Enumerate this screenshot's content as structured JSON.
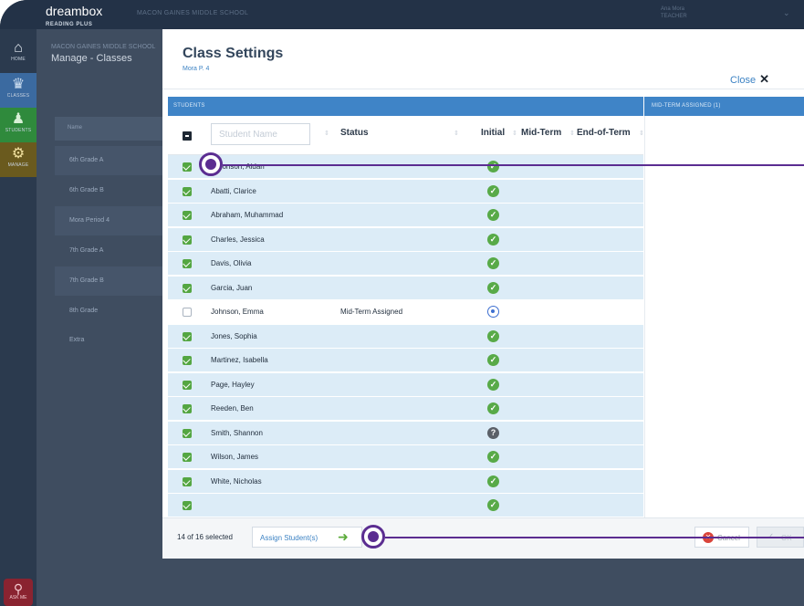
{
  "app": {
    "logo": "dreambox",
    "logo_sub": "READING PLUS",
    "school": "MACON GAINES MIDDLE SCHOOL",
    "user_name": "Ana Mora",
    "user_role": "TEACHER"
  },
  "rail": {
    "items": [
      {
        "label": "HOME",
        "icon": "home-icon"
      },
      {
        "label": "CLASSES",
        "icon": "classes-icon"
      },
      {
        "label": "STUDENTS",
        "icon": "students-icon"
      },
      {
        "label": "MANAGE",
        "icon": "gear-icon"
      }
    ],
    "bottom_label": "ASK ME"
  },
  "background": {
    "school": "MACON GAINES MIDDLE SCHOOL",
    "title": "Manage - Classes",
    "column": "Name",
    "classes": [
      "6th Grade A",
      "6th Grade B",
      "Mora Period 4",
      "7th Grade A",
      "7th Grade B",
      "8th Grade",
      "Extra"
    ]
  },
  "modal": {
    "title": "Class Settings",
    "subtitle": "Mora P. 4",
    "close_label": "Close",
    "students_header": "STUDENTS",
    "midterm_header": "MID-TERM ASSIGNED (1)",
    "search_placeholder": "Student Name",
    "columns": {
      "status": "Status",
      "initial": "Initial",
      "midterm": "Mid-Term",
      "endterm": "End-of-Term"
    },
    "students": [
      {
        "name": "Aaronson, Aidan",
        "status": "",
        "checked": true,
        "initial": "done"
      },
      {
        "name": "Abatti, Clarice",
        "status": "",
        "checked": true,
        "initial": "done"
      },
      {
        "name": "Abraham, Muhammad",
        "status": "",
        "checked": true,
        "initial": "done"
      },
      {
        "name": "Charles, Jessica",
        "status": "",
        "checked": true,
        "initial": "done"
      },
      {
        "name": "Davis, Olivia",
        "status": "",
        "checked": true,
        "initial": "done"
      },
      {
        "name": "Garcia, Juan",
        "status": "",
        "checked": true,
        "initial": "done"
      },
      {
        "name": "Johnson, Emma",
        "status": "Mid-Term Assigned",
        "checked": false,
        "initial": "progress"
      },
      {
        "name": "Jones, Sophia",
        "status": "",
        "checked": true,
        "initial": "done"
      },
      {
        "name": "Martinez, Isabella",
        "status": "",
        "checked": true,
        "initial": "done"
      },
      {
        "name": "Page, Hayley",
        "status": "",
        "checked": true,
        "initial": "done"
      },
      {
        "name": "Reeden, Ben",
        "status": "",
        "checked": true,
        "initial": "done"
      },
      {
        "name": "Smith, Shannon",
        "status": "",
        "checked": true,
        "initial": "question"
      },
      {
        "name": "Wilson, James",
        "status": "",
        "checked": true,
        "initial": "done"
      },
      {
        "name": "White, Nicholas",
        "status": "",
        "checked": true,
        "initial": "done"
      },
      {
        "name": "",
        "status": "",
        "checked": true,
        "initial": "done"
      }
    ],
    "footer": {
      "selected_count": "14 of 16 selected",
      "assign_label": "Assign Student(s)",
      "cancel_label": "Cancel",
      "ok_label": "OK"
    }
  },
  "colors": {
    "accent_blue": "#3f84c7",
    "check_green": "#58aa48",
    "callout_purple": "#5b2d91"
  }
}
